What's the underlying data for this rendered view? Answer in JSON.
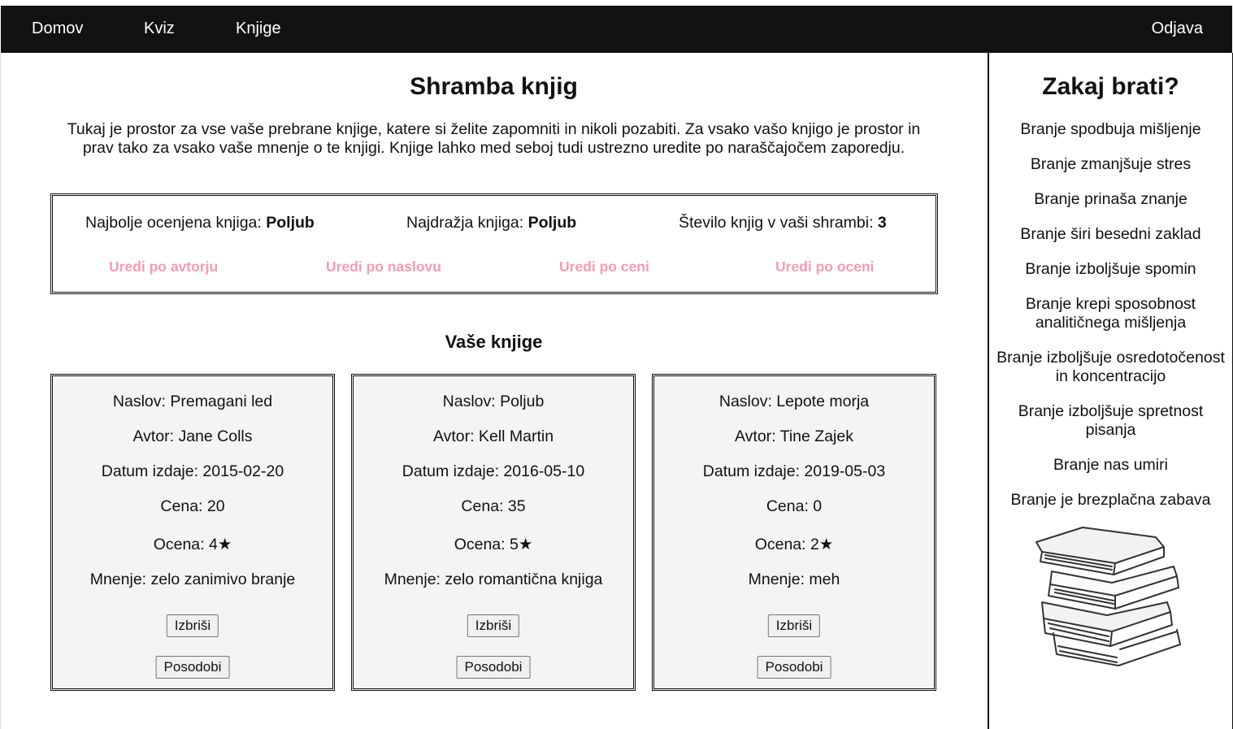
{
  "nav": {
    "home": "Domov",
    "quiz": "Kviz",
    "books": "Knjige",
    "logout": "Odjava"
  },
  "main": {
    "title": "Shramba knjig",
    "intro_line1": "Tukaj je prostor za vse vaše prebrane knjige, katere si želite zapomniti in nikoli pozabiti. Za vsako vašo knjigo je prostor in",
    "intro_line2": "prav tako za vsako vaše mnenje o te knjigi. Knjige lahko med seboj tudi ustrezno uredite po naraščajočem zaporedju.",
    "stats": {
      "best_rated_label": "Najbolje ocenjena knjiga: ",
      "best_rated_value": "Poljub",
      "favorite_label": "Najdražja knjiga: ",
      "favorite_value": "Poljub",
      "count_label": "Število knjig v vaši shrambi: ",
      "count_value": "3"
    },
    "sort": {
      "by_author": "Uredi po avtorju",
      "by_title": "Uredi po naslovu",
      "by_price": "Uredi po ceni",
      "by_rating": "Uredi po oceni"
    },
    "books_heading": "Vaše knjige",
    "books": [
      {
        "title": "Naslov: Premagani led",
        "author": "Avtor: Jane Colls",
        "date": "Datum izdaje: 2015-02-20",
        "price": "Cena: 20",
        "rating": "Ocena: 4★",
        "opinion": "Mnenje: zelo zanimivo branje",
        "delete_label": "Izbriši",
        "update_label": "Posodobi"
      },
      {
        "title": "Naslov: Poljub",
        "author": "Avtor: Kell Martin",
        "date": "Datum izdaje: 2016-05-10",
        "price": "Cena: 35",
        "rating": "Ocena: 5★",
        "opinion": "Mnenje: zelo romantična knjiga",
        "delete_label": "Izbriši",
        "update_label": "Posodobi"
      },
      {
        "title": "Naslov: Lepote morja",
        "author": "Avtor: Tine Zajek",
        "date": "Datum izdaje: 2019-05-03",
        "price": "Cena: 0",
        "rating": "Ocena: 2★",
        "opinion": "Mnenje: meh",
        "delete_label": "Izbriši",
        "update_label": "Posodobi"
      }
    ]
  },
  "sidebar": {
    "title": "Zakaj brati?",
    "reasons": [
      "Branje spodbuja mišljenje",
      "Branje zmanjšuje stres",
      "Branje prinaša znanje",
      "Branje širi besedni zaklad",
      "Branje izboljšuje spomin",
      "Branje krepi sposobnost analitičnega mišljenja",
      "Branje izboljšuje osredotočenost in koncentracijo",
      "Branje izboljšuje spretnost pisanja",
      "Branje nas umiri",
      "Branje je brezplačna zabava"
    ],
    "illustration_icon": "stack-of-books-icon"
  },
  "colors": {
    "nav_background": "#121212",
    "sort_link": "#f39cb0",
    "card_background": "#f4f4f4"
  }
}
